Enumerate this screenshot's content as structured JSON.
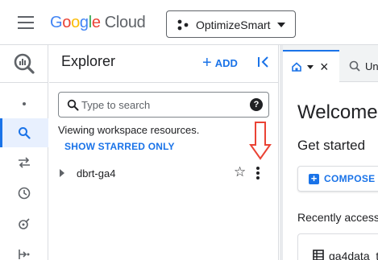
{
  "header": {
    "brand_google_letters": [
      "G",
      "o",
      "o",
      "g",
      "l",
      "e"
    ],
    "brand_cloud": "Cloud",
    "project_name": "OptimizeSmart",
    "menu_icon": "hamburger-menu-icon",
    "project_icon": "project-dots-icon"
  },
  "rail": {
    "logo_icon": "bigquery-logo-icon",
    "items": [
      {
        "icon": "dot-icon",
        "active": false
      },
      {
        "icon": "search-icon",
        "active": true
      },
      {
        "icon": "transfer-arrows-icon",
        "active": false
      },
      {
        "icon": "clock-icon",
        "active": false
      },
      {
        "icon": "analytics-hub-icon",
        "active": false
      },
      {
        "icon": "pipeline-icon",
        "active": false
      }
    ]
  },
  "explorer": {
    "title": "Explorer",
    "add_label": "ADD",
    "search_placeholder": "Type to search",
    "workspace_text": "Viewing workspace resources.",
    "starred_link": "SHOW STARRED ONLY",
    "tree": [
      {
        "name": "dbrt-ga4",
        "starred": false
      }
    ]
  },
  "tabs": {
    "home_close": "×",
    "untitled_label": "Un"
  },
  "main": {
    "welcome": "Welcome",
    "get_started": "Get started",
    "compose_label": "COMPOSE A",
    "recent_title": "Recently access",
    "recent_item": "ga4data_t"
  },
  "colors": {
    "accent": "#1a73e8",
    "annotation_arrow": "#ea4335"
  }
}
